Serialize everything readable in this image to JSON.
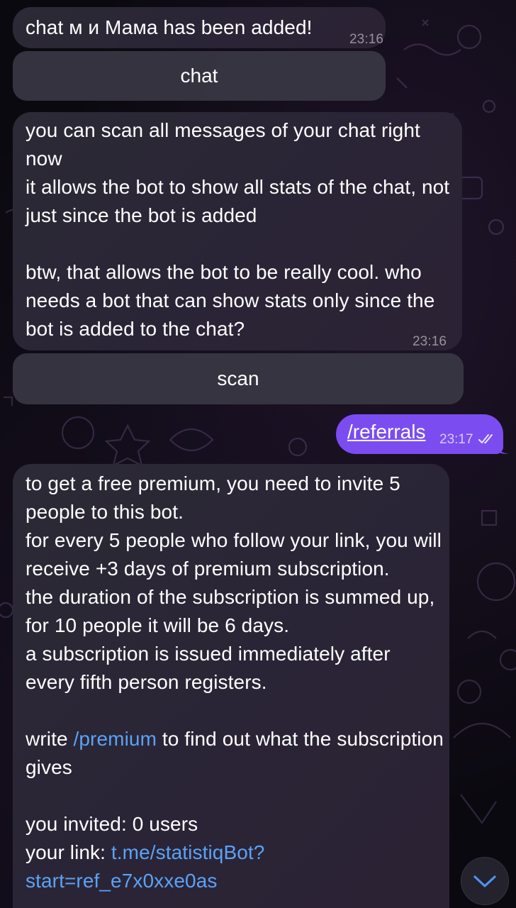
{
  "messages": {
    "added": {
      "text": "chat м и Мама has been added!",
      "time": "23:16"
    },
    "chat_button": "chat",
    "scan_info": {
      "text": "you can scan all messages of your chat right now\nit allows the bot to show all stats of the chat, not just since the bot is added\n\nbtw, that allows the bot to be really cool. who needs a bot that can show stats only since the bot is added to the chat?",
      "time": "23:16"
    },
    "scan_button": "scan",
    "outgoing": {
      "command": "/referrals",
      "time": "23:17"
    },
    "referral": {
      "body": "to get a free premium, you need to invite 5 people to this bot.\nfor every 5 people who follow your link, you will receive +3 days of premium subscription.\nthe duration of the subscription is summed up, for 10 people it will be 6 days.\na subscription is issued immediately after every fifth person registers.",
      "write_prefix": "write ",
      "premium_link": "/premium",
      "write_suffix": " to find out what the subscription gives",
      "invited": "you invited: 0 users",
      "your_link_label": "your link: ",
      "your_link": "t.me/statistiqBot?",
      "link_cut": "start=ref_e7x0xxe0as"
    }
  },
  "colors": {
    "outgoing_bubble": "#7b4cf0",
    "link": "#5ba2f7",
    "background": "#0b0910"
  },
  "icons": {
    "read_receipt": "double-check-icon",
    "scroll_down": "chevron-down-icon"
  }
}
